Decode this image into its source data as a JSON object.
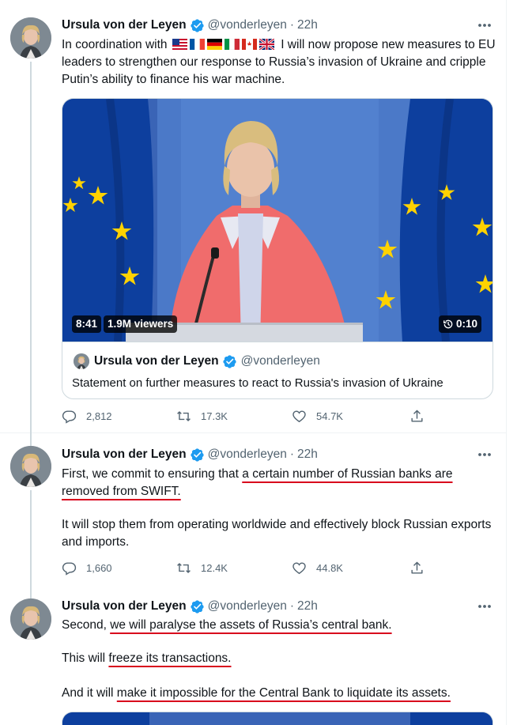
{
  "tweets": [
    {
      "author_name": "Ursula von der Leyen",
      "handle": "@vonderleyen",
      "time": "22h",
      "text_before_flags": "In coordination with",
      "text_after_flags": "I will now propose new measures to EU leaders to strengthen our response to Russia’s invasion of Ukraine and cripple Putin’s ability to finance his war machine.",
      "flags": [
        "US",
        "FR",
        "DE",
        "IT",
        "CA",
        "UK"
      ],
      "media": {
        "duration": "8:41",
        "viewers": "1.9M viewers",
        "remaining": "0:10",
        "card_author": "Ursula von der Leyen",
        "card_handle": "@vonderleyen",
        "card_title": "Statement on further measures to react to Russia's invasion of Ukraine"
      },
      "stats": {
        "replies": "2,812",
        "retweets": "17.3K",
        "likes": "54.7K"
      }
    },
    {
      "author_name": "Ursula von der Leyen",
      "handle": "@vonderleyen",
      "time": "22h",
      "p1_before": "First, we commit to ensuring that ",
      "p1_underlined": "a certain number of Russian banks are removed from SWIFT.",
      "p2": "It will stop them from operating worldwide and effectively block Russian exports and imports.",
      "stats": {
        "replies": "1,660",
        "retweets": "12.4K",
        "likes": "44.8K"
      }
    },
    {
      "author_name": "Ursula von der Leyen",
      "handle": "@vonderleyen",
      "time": "22h",
      "p1_before": "Second, ",
      "p1_underlined": "we will paralyse the assets of Russia’s central bank.",
      "p2_before": "This will ",
      "p2_underlined": "freeze its transactions.",
      "p3_before": "And it will ",
      "p3_underlined": "make it impossible for the Central Bank to liquidate its assets."
    }
  ],
  "colors": {
    "text": "#0f1419",
    "secondary": "#536471",
    "verified": "#1d9bf0",
    "annotation_red": "#d8001c",
    "divider": "#eff3f4"
  },
  "icons": [
    "reply-icon",
    "retweet-icon",
    "like-icon",
    "share-icon",
    "verified-badge-icon",
    "more-icon",
    "history-icon"
  ]
}
